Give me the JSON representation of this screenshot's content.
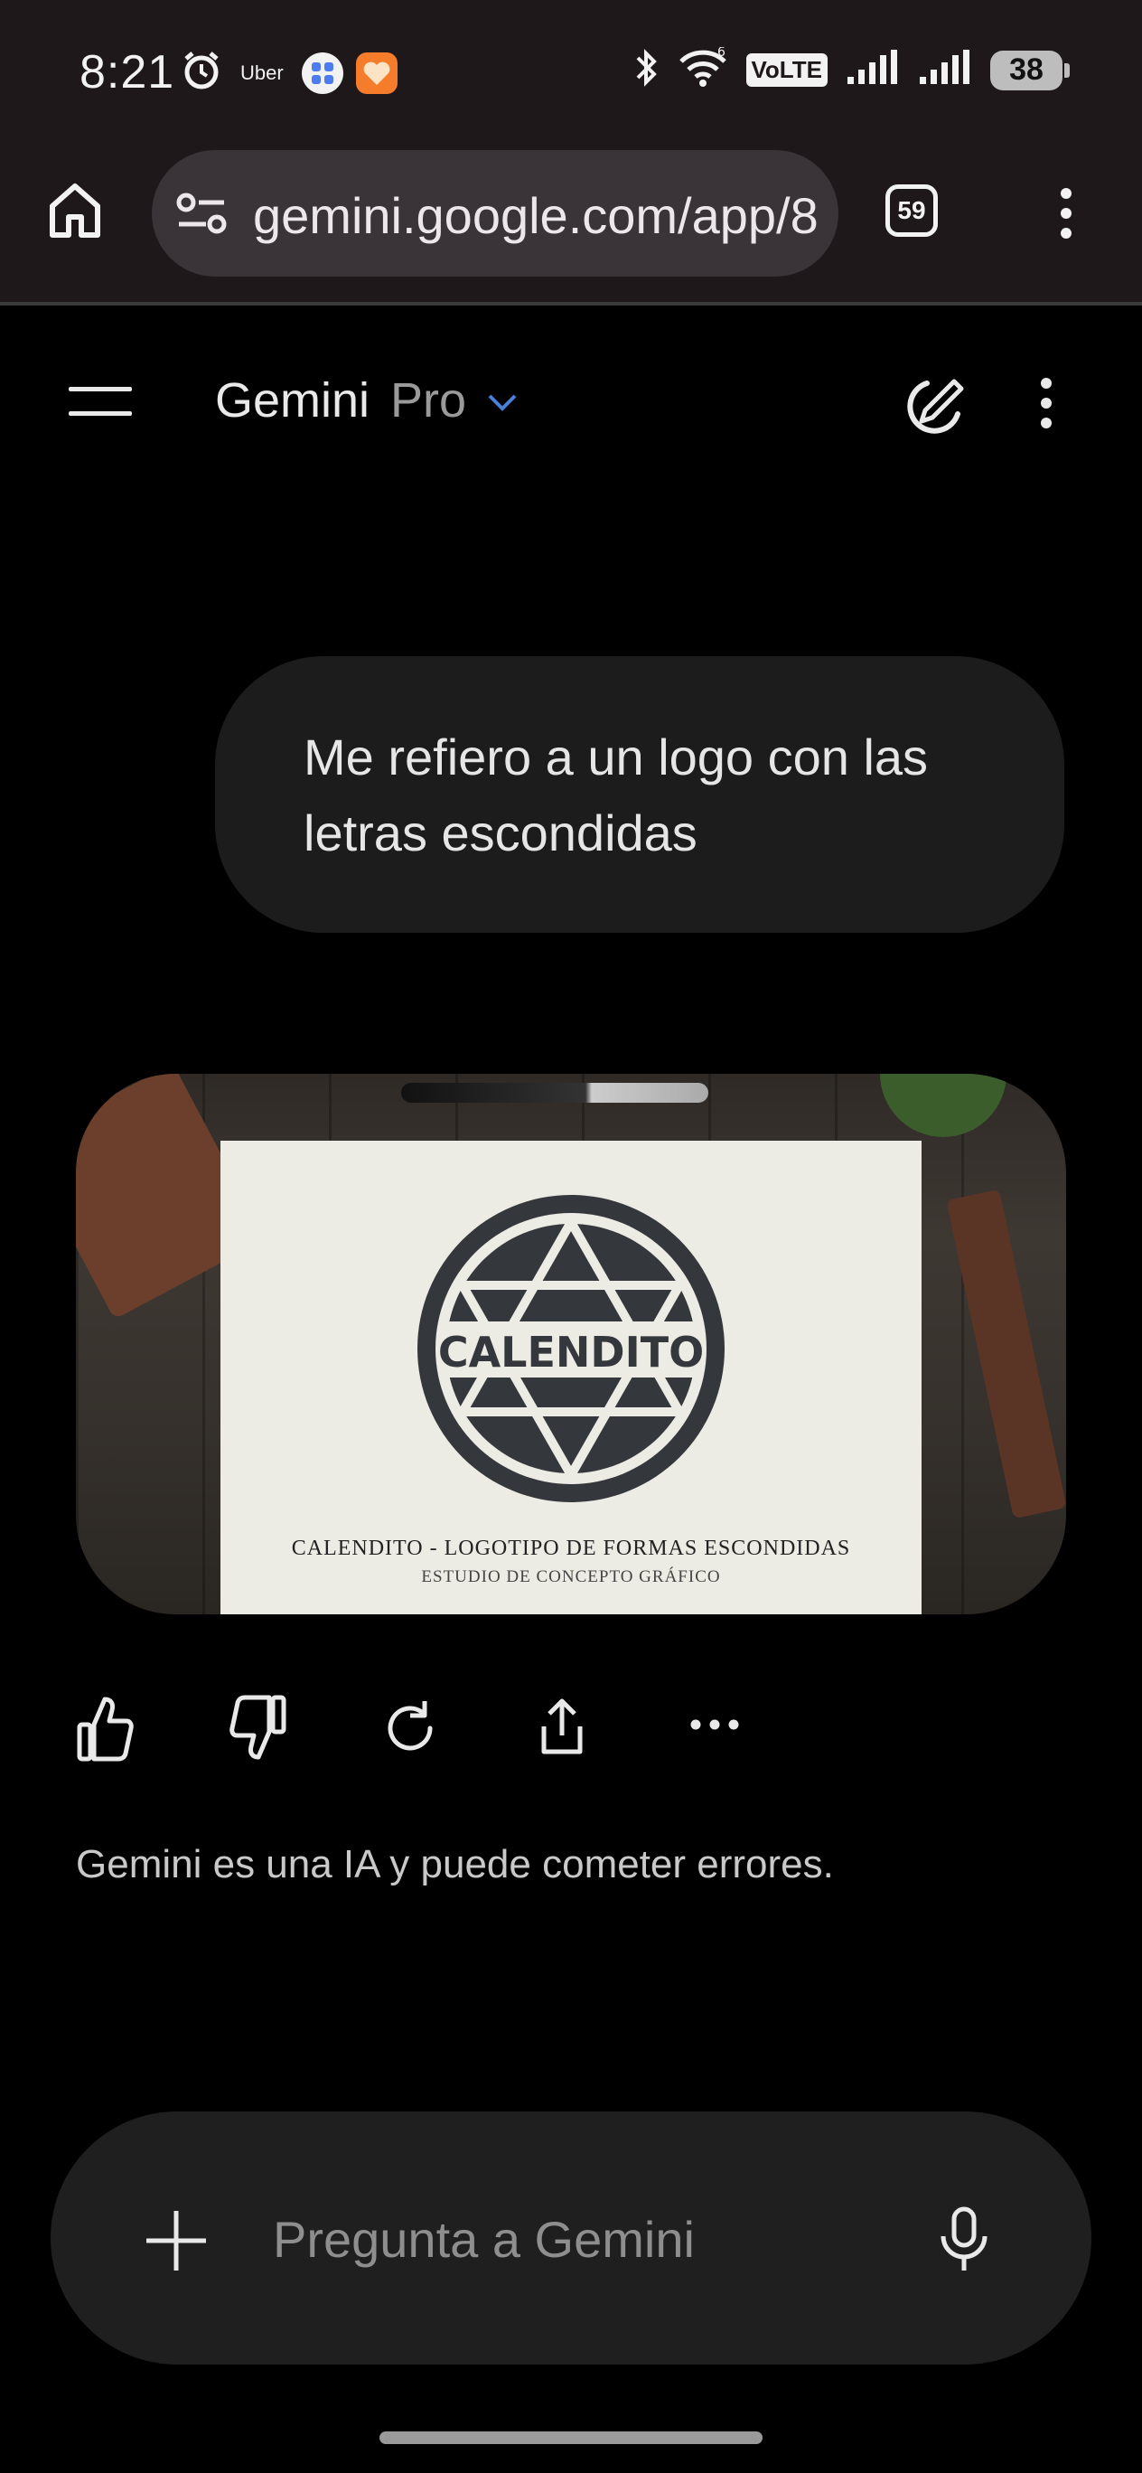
{
  "status_bar": {
    "time": "8:21",
    "uber_label": "Uber",
    "volte_label": "VoLTE",
    "battery_level": "38",
    "icons": [
      "alarm-icon",
      "uber-app-icon",
      "grid-app-icon",
      "heart-app-icon",
      "bluetooth-icon",
      "wifi-icon",
      "volte-icon",
      "signal-icon",
      "signal-icon",
      "battery-icon"
    ]
  },
  "browser": {
    "url": "gemini.google.com/app/8",
    "tab_count": "59",
    "icons": [
      "home-icon",
      "site-settings-icon",
      "tabs-icon",
      "more-vert-icon"
    ]
  },
  "header": {
    "title": "Gemini",
    "model": "Pro",
    "icons": [
      "menu-icon",
      "chevron-down-icon",
      "new-chat-icon",
      "more-vert-icon"
    ]
  },
  "chat": {
    "user_message": "Me refiero a un logo con las letras escondidas",
    "image": {
      "logo_word": "CALENDITO",
      "caption_main": "CALENDITO - LOGOTIPO DE FORMAS ESCONDIDAS",
      "caption_sub": "ESTUDIO DE CONCEPTO GRÁFICO"
    },
    "actions": [
      "thumb-up-icon",
      "thumb-down-icon",
      "regenerate-icon",
      "share-icon",
      "more-horiz-icon"
    ],
    "disclaimer": "Gemini es una IA y puede cometer errores."
  },
  "input": {
    "placeholder": "Pregunta a Gemini",
    "value": "",
    "icons": [
      "add-icon",
      "microphone-icon"
    ]
  },
  "colors": {
    "background": "#000000",
    "status_bar": "#1e181b",
    "url_pill": "#3a3337",
    "user_bubble": "#1c1c1c",
    "input_pill": "#1f1f1f",
    "accent_chevron": "#4a7fd6"
  }
}
